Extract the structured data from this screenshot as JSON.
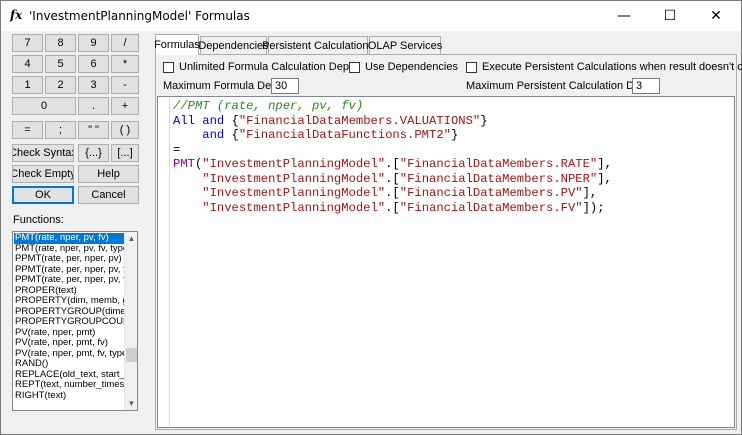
{
  "window": {
    "title": "'InvestmentPlanningModel' Formulas",
    "icon": "fx",
    "minimize": "—",
    "maximize": "☐",
    "close": "✕"
  },
  "keypad": {
    "row1": [
      "7",
      "8",
      "9",
      "/"
    ],
    "row2": [
      "4",
      "5",
      "6",
      "*"
    ],
    "row3": [
      "1",
      "2",
      "3",
      "-"
    ],
    "row4": [
      "0",
      ".",
      "+"
    ],
    "row5": [
      "=",
      ";",
      "\" \"",
      "( )"
    ],
    "check_syntax": "Check Syntax",
    "braces": "{...}",
    "brackets": "[...]",
    "check_empty": "Check Empty",
    "help": "Help",
    "ok": "OK",
    "cancel": "Cancel"
  },
  "functions": {
    "label": "Functions:",
    "items": [
      "PMT(rate, nper, pv, fv)",
      "PMT(rate, nper, pv, fv, type)",
      "PPMT(rate, per, nper, pv)",
      "PPMT(rate, per, nper, pv, fv)",
      "PPMT(rate, per, nper, pv, fv, type)",
      "PROPER(text)",
      "PROPERTY(dim, memb, group)",
      "PROPERTYGROUP(dimension)",
      "PROPERTYGROUPCOUNT(dimension)",
      "PV(rate, nper, pmt)",
      "PV(rate, nper, pmt, fv)",
      "PV(rate, nper, pmt, fv, type)",
      "RAND()",
      "REPLACE(old_text, start_num)",
      "REPT(text, number_times)",
      "RIGHT(text)"
    ],
    "selected_index": 0
  },
  "tabs": [
    {
      "label": "Formulas",
      "active": true
    },
    {
      "label": "Dependencies",
      "active": false
    },
    {
      "label": "Persistent Calculations",
      "active": false
    },
    {
      "label": "OLAP Services",
      "active": false
    }
  ],
  "options": {
    "unlimited_depth": {
      "label": "Unlimited Formula Calculation Depth",
      "checked": false
    },
    "use_dependencies": {
      "label": "Use Dependencies",
      "checked": false
    },
    "execute_persistent": {
      "label": "Execute Persistent Calculations when result doesn't change",
      "checked": false
    },
    "max_depth_label": "Maximum Formula Depth:",
    "max_depth_value": "30",
    "max_persistent_label": "Maximum Persistent Calculation Depth:",
    "max_persistent_value": "3"
  },
  "code_lines": [
    [
      {
        "t": "//PMT (rate, nper, pv, fv)",
        "c": "comment"
      }
    ],
    [
      {
        "t": "All ",
        "c": "kw"
      },
      {
        "t": "and ",
        "c": "kw"
      },
      {
        "t": "{",
        "c": "op"
      },
      {
        "t": "\"FinancialDataMembers.VALUATIONS\"",
        "c": "str"
      },
      {
        "t": "}",
        "c": "op"
      }
    ],
    [
      {
        "t": "    and ",
        "c": "kw"
      },
      {
        "t": "{",
        "c": "op"
      },
      {
        "t": "\"FinancialDataFunctions.PMT2\"",
        "c": "str"
      },
      {
        "t": "}",
        "c": "op"
      }
    ],
    [
      {
        "t": "=",
        "c": "op"
      }
    ],
    [
      {
        "t": "PMT",
        "c": "fn"
      },
      {
        "t": "(",
        "c": "op"
      },
      {
        "t": "\"InvestmentPlanningModel\"",
        "c": "str"
      },
      {
        "t": ".[",
        "c": "op"
      },
      {
        "t": "\"FinancialDataMembers.RATE\"",
        "c": "str"
      },
      {
        "t": "],",
        "c": "op"
      }
    ],
    [
      {
        "t": "    \"InvestmentPlanningModel\"",
        "c": "str"
      },
      {
        "t": ".[",
        "c": "op"
      },
      {
        "t": "\"FinancialDataMembers.NPER\"",
        "c": "str"
      },
      {
        "t": "],",
        "c": "op"
      }
    ],
    [
      {
        "t": "    \"InvestmentPlanningModel\"",
        "c": "str"
      },
      {
        "t": ".[",
        "c": "op"
      },
      {
        "t": "\"FinancialDataMembers.PV\"",
        "c": "str"
      },
      {
        "t": "],",
        "c": "op"
      }
    ],
    [
      {
        "t": "    \"InvestmentPlanningModel\"",
        "c": "str"
      },
      {
        "t": ".[",
        "c": "op"
      },
      {
        "t": "\"FinancialDataMembers.FV\"",
        "c": "str"
      },
      {
        "t": "]);",
        "c": "op"
      }
    ]
  ],
  "colors": {
    "selection": "#0078d7",
    "comment": "#228b22",
    "keyword": "#0000cc",
    "string": "#a31515",
    "function": "#8b008b"
  }
}
